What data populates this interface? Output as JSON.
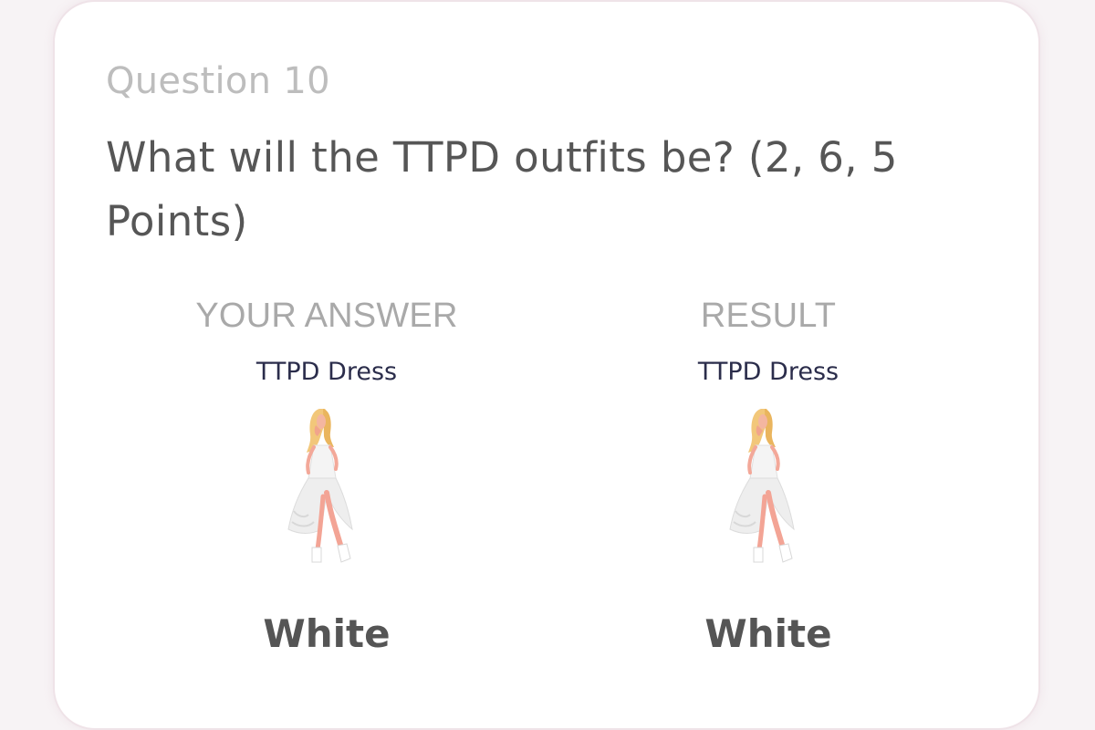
{
  "question": {
    "number_label": "Question 10",
    "title": "What will the TTPD outfits be? (2, 6, 5 Points)"
  },
  "columns": [
    {
      "header": "YOUR ANSWER",
      "outfit": "TTPD Dress",
      "image_icon": "white-dress-illustration",
      "color": "White"
    },
    {
      "header": "RESULT",
      "outfit": "TTPD Dress",
      "image_icon": "white-dress-illustration",
      "color": "White"
    }
  ],
  "colors": {
    "card_bg": "#ffffff",
    "card_border": "#efe3e8",
    "question_number": "#bdbdbd",
    "question_title": "#565656",
    "column_header": "#a9a9a9",
    "outfit_name": "#2b2d4b",
    "color_text": "#555555"
  }
}
